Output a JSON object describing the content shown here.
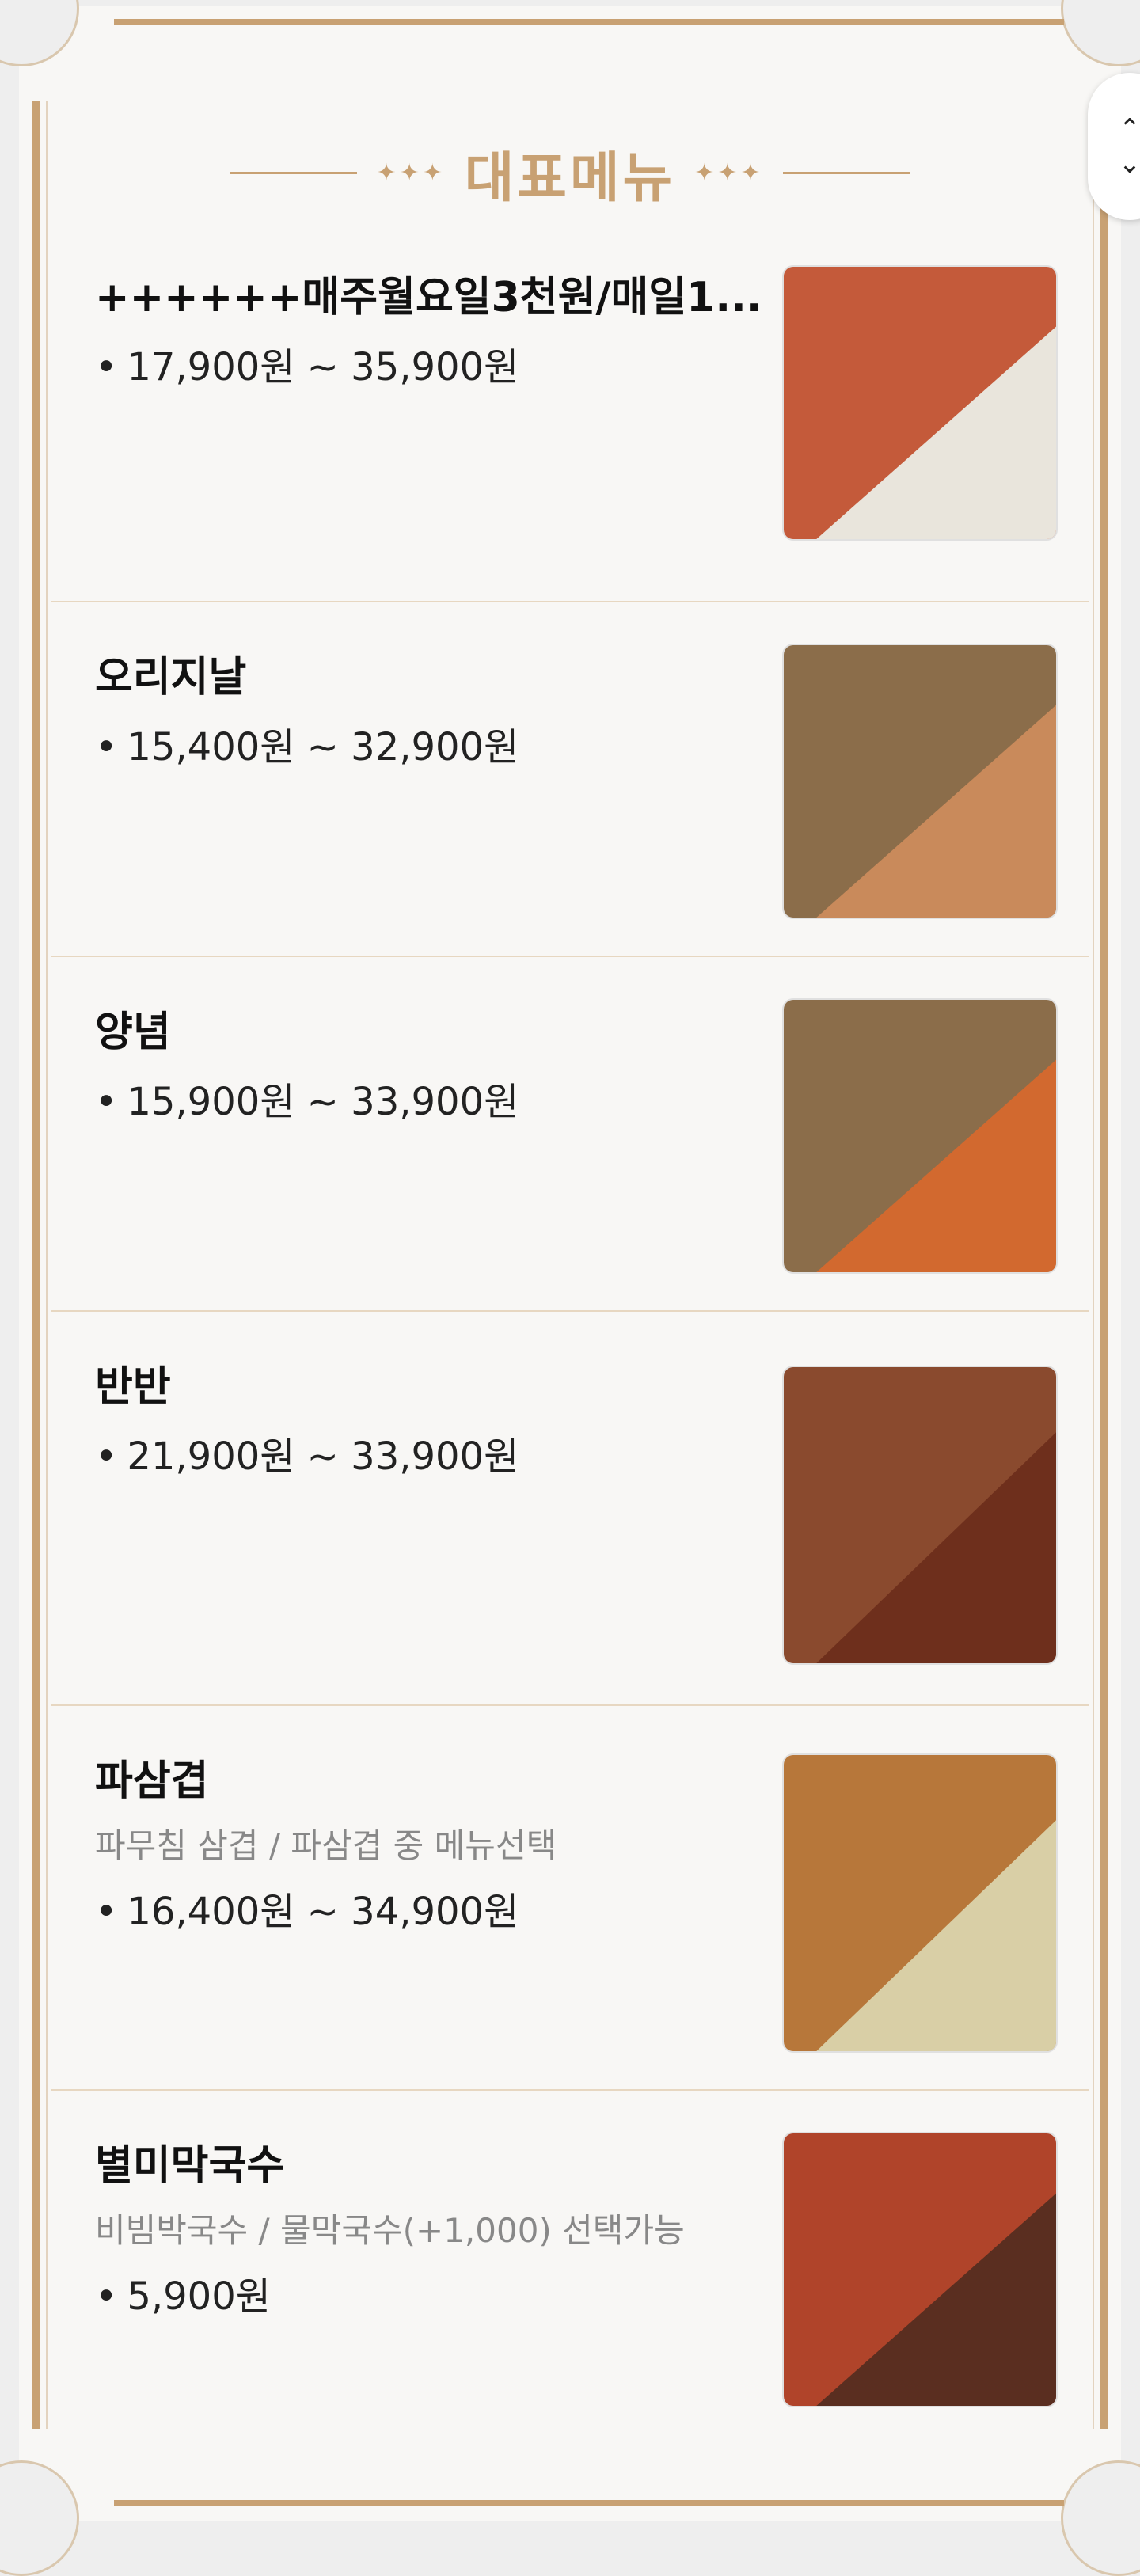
{
  "header": {
    "title": "대표메뉴",
    "ornament_left": "✦✦✦",
    "ornament_right": "✦✦✦"
  },
  "scroll_control": {
    "up_icon": "chevron-up-icon",
    "down_icon": "chevron-down-icon"
  },
  "colors": {
    "accent": "#c8a173",
    "divider": "#e7d7c1",
    "background": "#f8f7f5"
  },
  "menu": [
    {
      "name": "++++++매주월요일3천원/매일1...",
      "description": "",
      "price": "17,900원 ~ 35,900원",
      "image": "pasta-and-chicken-photo",
      "colors": [
        "#c45a3a",
        "#e9e5dc"
      ]
    },
    {
      "name": "오리지날",
      "description": "",
      "price": "15,400원 ~ 32,900원",
      "image": "original-meal-set-photo",
      "colors": [
        "#8b6d4a",
        "#c98a5b"
      ]
    },
    {
      "name": "양념",
      "description": "",
      "price": "15,900원 ~ 33,900원",
      "image": "seasoned-meal-set-photo",
      "colors": [
        "#8b6d4a",
        "#d2692f"
      ]
    },
    {
      "name": "반반",
      "description": "",
      "price": "21,900원 ~ 33,900원",
      "image": "half-half-grilled-photo",
      "colors": [
        "#8a4a2e",
        "#6e2f1c"
      ]
    },
    {
      "name": "파삼겹",
      "description": "파무침 삼겹 / 파삼겹 중 메뉴선택",
      "price": "16,400원 ~ 34,900원",
      "image": "green-onion-pork-belly-photo",
      "colors": [
        "#b7773a",
        "#d9cfa6"
      ]
    },
    {
      "name": "별미막국수",
      "description": "비빔박국수 / 물막국수(+1,000) 선택가능",
      "price": "5,900원",
      "image": "buckwheat-noodles-photo",
      "colors": [
        "#b0442a",
        "#5a2e20"
      ]
    }
  ],
  "bullet": "•"
}
